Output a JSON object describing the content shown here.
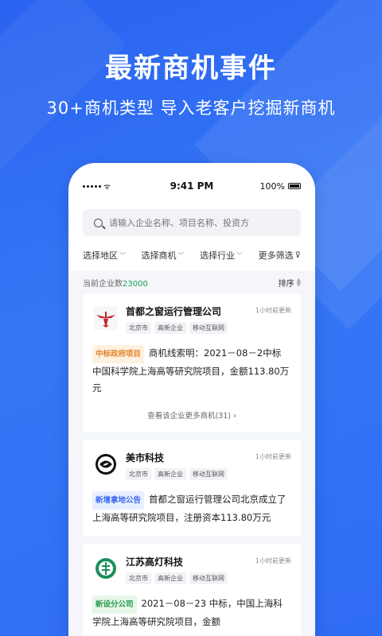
{
  "banner": {
    "title": "最新商机事件",
    "subtitle": "30+商机类型  导入老客户挖掘新商机"
  },
  "status_bar": {
    "time": "9:41 PM",
    "battery": "100%"
  },
  "search": {
    "placeholder": "请输入企业名称、项目名称、投资方"
  },
  "filters": [
    {
      "label": "选择地区"
    },
    {
      "label": "选择商机"
    },
    {
      "label": "选择行业"
    },
    {
      "label": "更多筛选"
    }
  ],
  "count_bar": {
    "label": "当前企业数",
    "count": "23000",
    "sort_label": "排序"
  },
  "cards": [
    {
      "company": "首都之窗运行管理公司",
      "time": "1小时前更新",
      "tags": [
        "北京市",
        "高新企业",
        "移动互联网"
      ],
      "badge": "中标政府项目",
      "badge_color": "#e0852b",
      "text": "商机线索明：2021－08－2中标 中国科学院上海高等研究院项目，金额113.80万元",
      "more": "查看该企业更多商机(31)",
      "logo_icon": "eagle-emblem-icon"
    },
    {
      "company": "美市科技",
      "time": "1小时前更新",
      "tags": [
        "北京市",
        "高新企业",
        "移动互联网"
      ],
      "badge": "新增拿地公告",
      "badge_color": "#3c6af0",
      "text": "首都之窗运行管理公司北京成立了上海高等研究院项目，注册资本113.80万元",
      "logo_icon": "swirl-emblem-icon"
    },
    {
      "company": "江苏高灯科技",
      "time": "1小时前更新",
      "tags": [
        "北京市",
        "高新企业",
        "移动互联网"
      ],
      "badge": "新设分公司",
      "badge_color": "#2a9b4f",
      "text": "2021－08－23 中标，中国上海科学院上海高等研究院项目，金额",
      "logo_icon": "bank-emblem-icon"
    }
  ]
}
